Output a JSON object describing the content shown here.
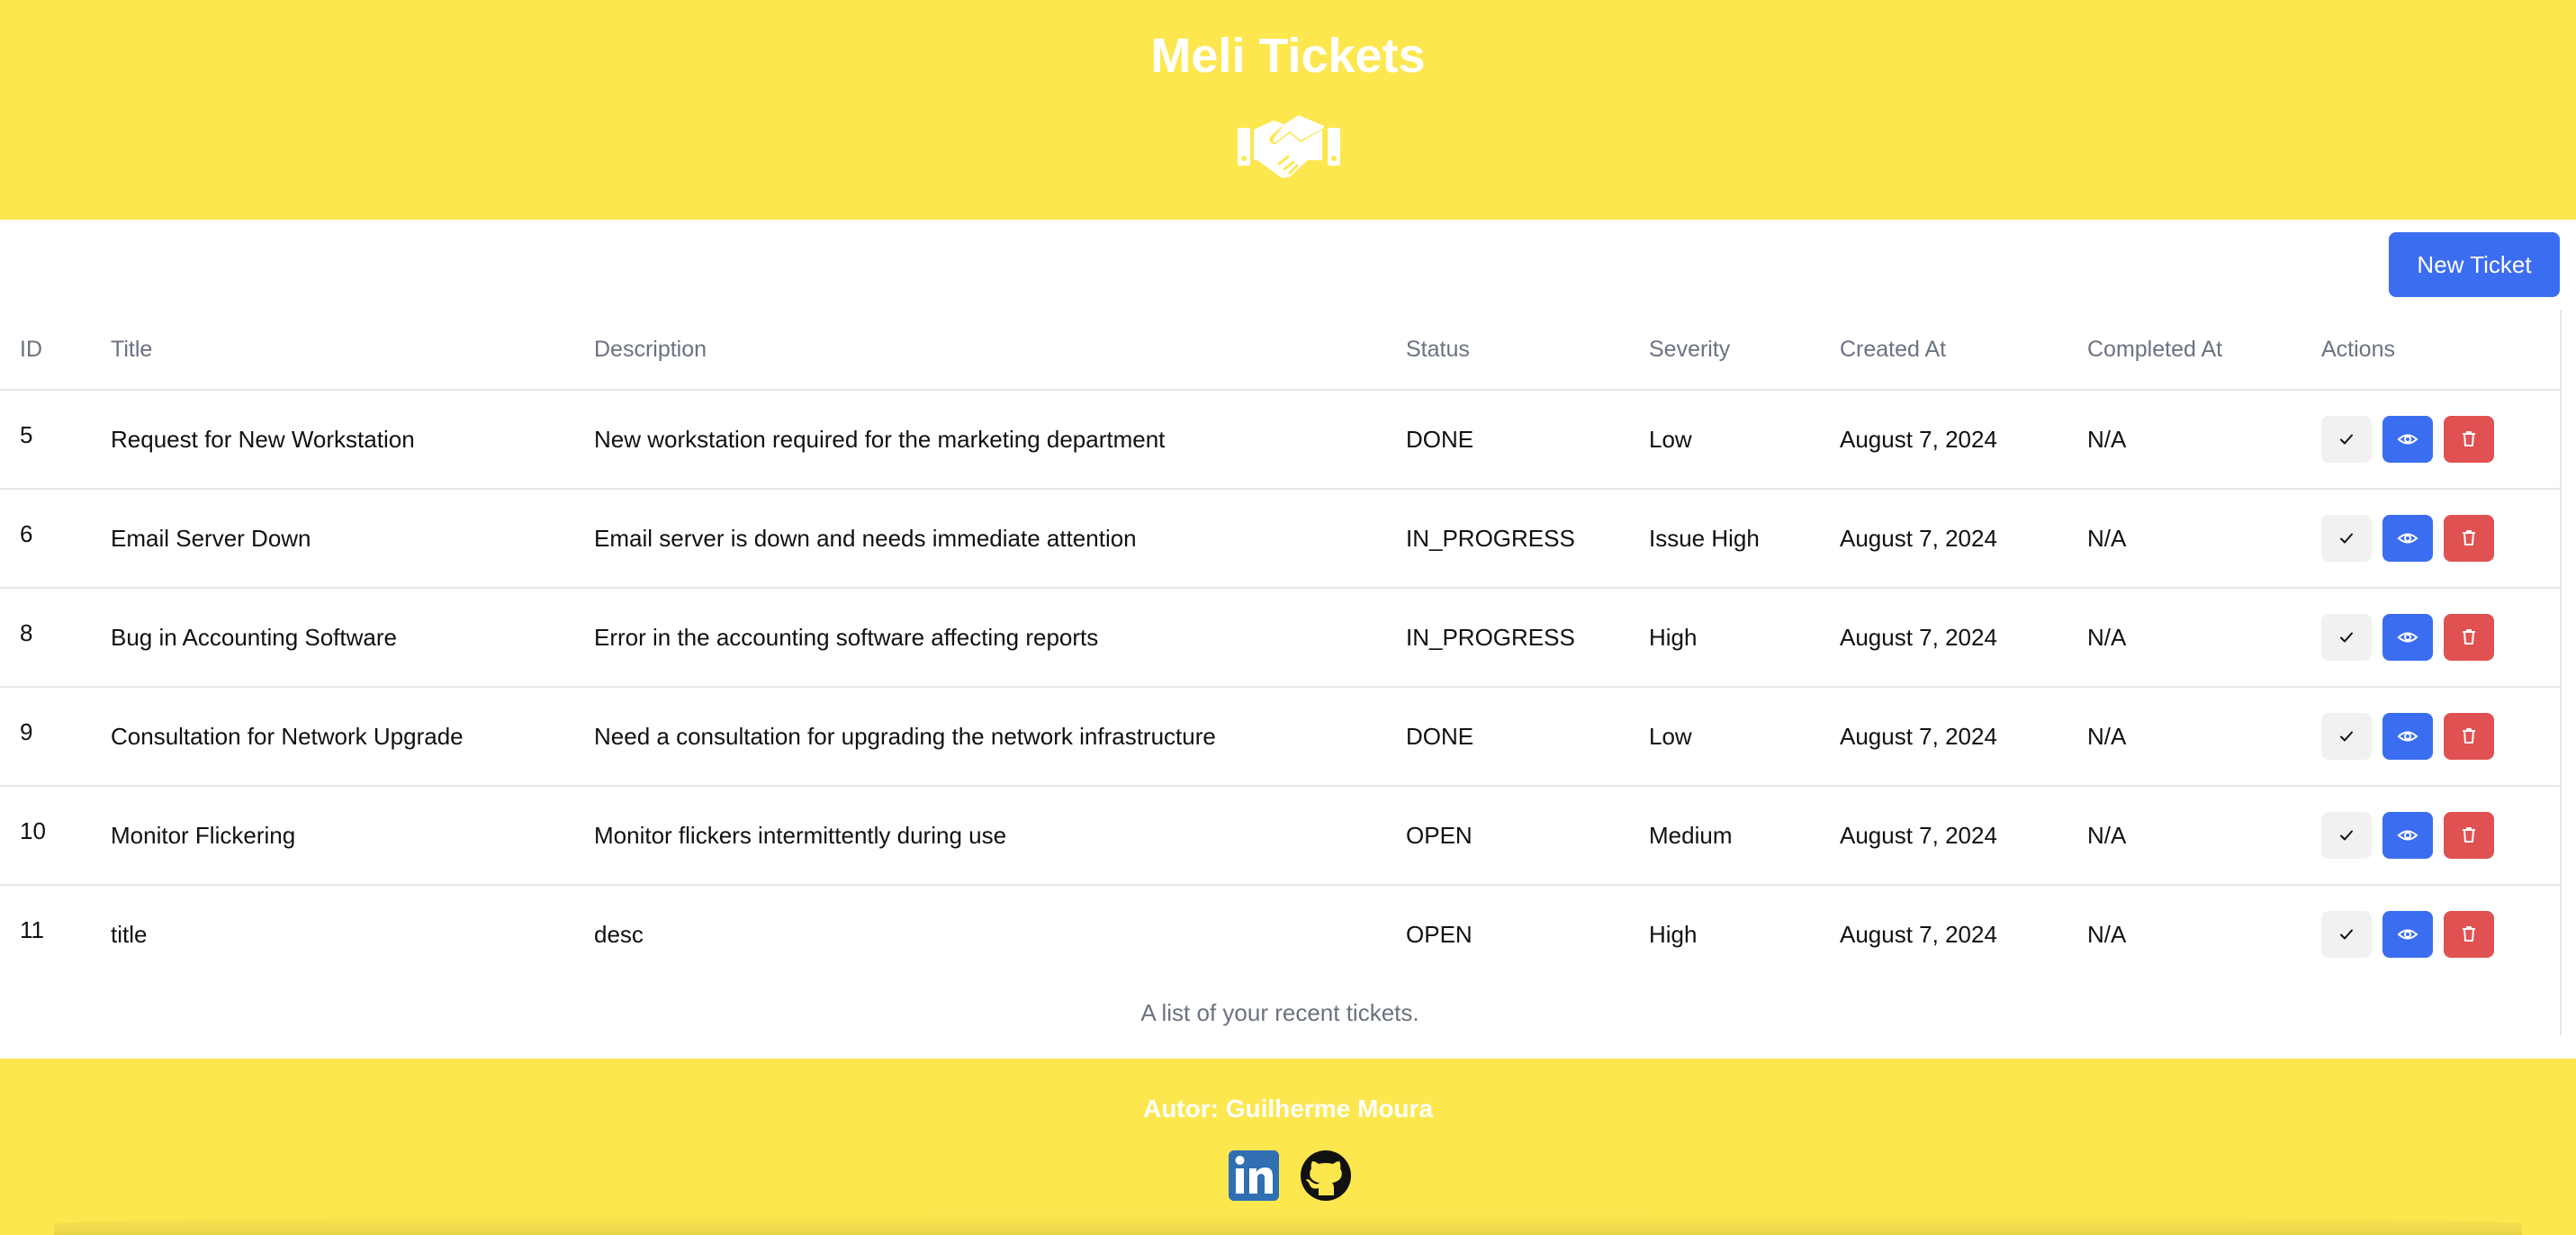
{
  "header": {
    "title": "Meli Tickets",
    "logo_icon": "handshake-icon"
  },
  "toolbar": {
    "new_ticket_label": "New Ticket"
  },
  "table": {
    "columns": [
      "ID",
      "Title",
      "Description",
      "Status",
      "Severity",
      "Created At",
      "Completed At",
      "Actions"
    ],
    "rows": [
      {
        "id": "5",
        "title": "Request for New Workstation",
        "description": "New workstation required for the marketing department",
        "status": "DONE",
        "severity": "Low",
        "created_at": "August 7, 2024",
        "completed_at": "N/A"
      },
      {
        "id": "6",
        "title": "Email Server Down",
        "description": "Email server is down and needs immediate attention",
        "status": "IN_PROGRESS",
        "severity": "Issue High",
        "created_at": "August 7, 2024",
        "completed_at": "N/A"
      },
      {
        "id": "8",
        "title": "Bug in Accounting Software",
        "description": "Error in the accounting software affecting reports",
        "status": "IN_PROGRESS",
        "severity": "High",
        "created_at": "August 7, 2024",
        "completed_at": "N/A"
      },
      {
        "id": "9",
        "title": "Consultation for Network Upgrade",
        "description": "Need a consultation for upgrading the network infrastructure",
        "status": "DONE",
        "severity": "Low",
        "created_at": "August 7, 2024",
        "completed_at": "N/A"
      },
      {
        "id": "10",
        "title": "Monitor Flickering",
        "description": "Monitor flickers intermittently during use",
        "status": "OPEN",
        "severity": "Medium",
        "created_at": "August 7, 2024",
        "completed_at": "N/A"
      },
      {
        "id": "11",
        "title": "title",
        "description": "desc",
        "status": "OPEN",
        "severity": "High",
        "created_at": "August 7, 2024",
        "completed_at": "N/A"
      }
    ],
    "caption": "A list of your recent tickets.",
    "action_icons": [
      "check-icon",
      "eye-icon",
      "trash-icon"
    ]
  },
  "footer": {
    "author": "Autor: Guilherme Moura",
    "social_icons": [
      "linkedin-icon",
      "github-icon"
    ]
  },
  "colors": {
    "header_bg": "#fce74f",
    "primary": "#3b6df0",
    "danger": "#e05151",
    "muted_text": "#6b7280"
  }
}
